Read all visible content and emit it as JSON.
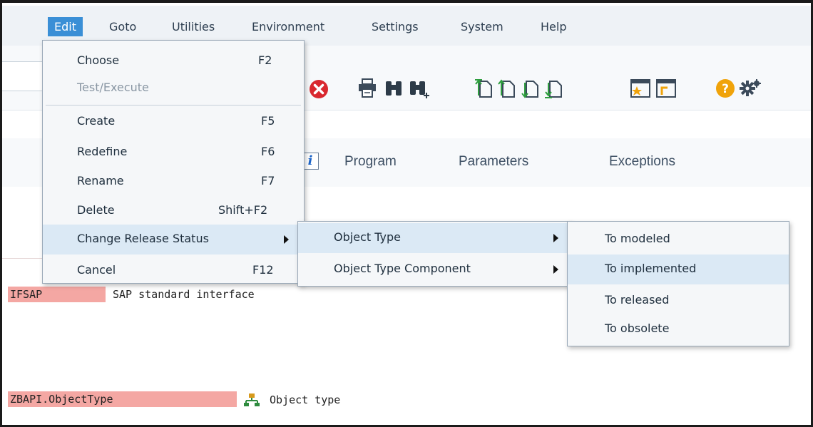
{
  "menubar": {
    "items": [
      "Edit",
      "Goto",
      "Utilities",
      "Environment",
      "Settings",
      "System",
      "Help"
    ]
  },
  "tabs": [
    "Program",
    "Parameters",
    "Exceptions"
  ],
  "content": {
    "rows": [
      {
        "field": "IFSAP",
        "text": "SAP standard interface"
      },
      {
        "field": "ZBAPI.ObjectType",
        "text": "Object type"
      }
    ]
  },
  "edit_menu": {
    "items": [
      {
        "label": "Choose",
        "shortcut": "F2"
      },
      {
        "label": "Test/Execute",
        "shortcut": ""
      },
      {
        "label": "Create",
        "shortcut": "F5"
      },
      {
        "label": "Redefine",
        "shortcut": "F6"
      },
      {
        "label": "Rename",
        "shortcut": "F7"
      },
      {
        "label": "Delete",
        "shortcut": "Shift+F2"
      },
      {
        "label": "Change Release Status",
        "shortcut": ""
      },
      {
        "label": "Cancel",
        "shortcut": "F12"
      }
    ]
  },
  "release_submenu": {
    "items": [
      {
        "label": "Object Type"
      },
      {
        "label": "Object Type Component"
      }
    ]
  },
  "status_submenu": {
    "items": [
      {
        "label": "To modeled"
      },
      {
        "label": "To implemented"
      },
      {
        "label": "To released"
      },
      {
        "label": "To obsolete"
      }
    ]
  },
  "colors": {
    "menubar_bg": "#eef2f6",
    "active_menu": "#3a8fd6",
    "highlight": "#dbe9f5",
    "field_red": "#f4a7a3",
    "cancel_red": "#d9282f",
    "help_orange": "#f0a30a"
  },
  "icons": [
    "cancel-icon",
    "print-icon",
    "find-icon",
    "find-next-icon",
    "first-page-icon",
    "previous-page-icon",
    "next-page-icon",
    "last-page-icon",
    "create-session-icon",
    "generate-shortcut-icon",
    "help-icon",
    "settings-gear-icon",
    "hierarchy-icon",
    "info-icon"
  ]
}
